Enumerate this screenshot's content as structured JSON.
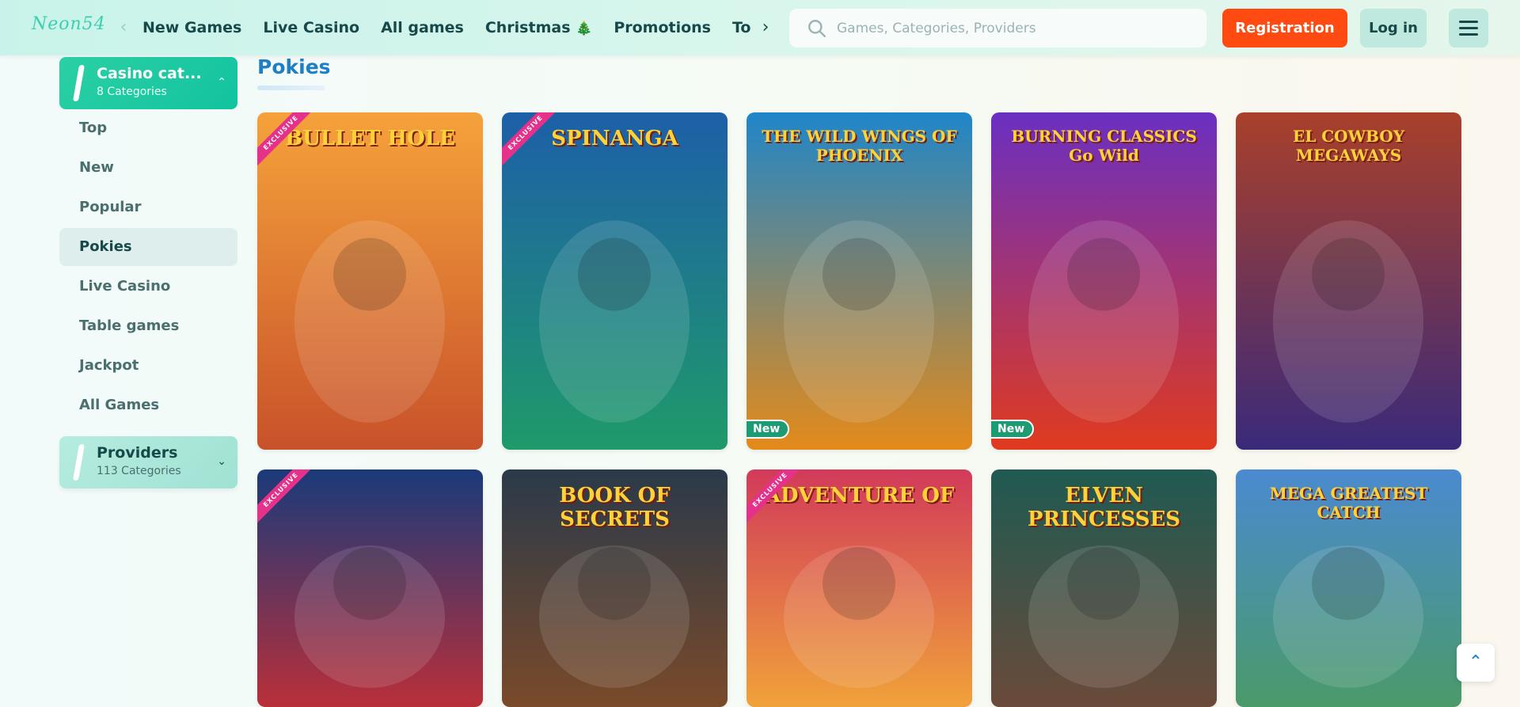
{
  "header": {
    "logo": "Neon54",
    "nav": [
      "New Games",
      "Live Casino",
      "All games",
      "Christmas",
      "Promotions",
      "Tournamer"
    ],
    "search_placeholder": "Games, Categories, Providers",
    "register_label": "Registration",
    "login_label": "Log in"
  },
  "sidebar": {
    "casino_title": "Casino cat...",
    "casino_sub": "8 Categories",
    "items": [
      "Top",
      "New",
      "Popular",
      "Pokies",
      "Live Casino",
      "Table games",
      "Jackpot",
      "All Games"
    ],
    "active": "Pokies",
    "providers_title": "Providers",
    "providers_sub": "113 Categories"
  },
  "main": {
    "title": "Pokies",
    "ribbon_text": "EXCLUSIVE",
    "new_badge": "New",
    "games": [
      {
        "title": "BULLET HOLE",
        "colors": [
          "#f5a23b",
          "#c8522a"
        ],
        "exclusive": true,
        "new": false
      },
      {
        "title": "SPINANGA",
        "colors": [
          "#1d5fa8",
          "#1f9a6a"
        ],
        "exclusive": true,
        "new": false
      },
      {
        "title": "THE WILD WINGS OF PHOENIX",
        "colors": [
          "#1f86c9",
          "#e48a1a"
        ],
        "exclusive": false,
        "new": true
      },
      {
        "title": "BURNING CLASSICS Go Wild",
        "colors": [
          "#6a2fc2",
          "#e03a1e"
        ],
        "exclusive": false,
        "new": true
      },
      {
        "title": "EL COWBOY MEGAWAYS",
        "colors": [
          "#a9402b",
          "#3a2a7a"
        ],
        "exclusive": false,
        "new": false
      },
      {
        "title": "",
        "colors": [
          "#1a3a7a",
          "#b92f3a"
        ],
        "exclusive": true,
        "new": false
      },
      {
        "title": "BOOK OF SECRETS",
        "colors": [
          "#2a3a4a",
          "#7a4a2a"
        ],
        "exclusive": false,
        "new": false
      },
      {
        "title": "ADVENTURE OF",
        "colors": [
          "#d23a5a",
          "#f0a23a"
        ],
        "exclusive": true,
        "new": false
      },
      {
        "title": "ELVEN PRINCESSES",
        "colors": [
          "#1f5a52",
          "#6a4a3a"
        ],
        "exclusive": false,
        "new": false
      },
      {
        "title": "MEGA GREATEST CATCH",
        "colors": [
          "#4a8ad0",
          "#4a9a6a"
        ],
        "exclusive": false,
        "new": false
      }
    ]
  }
}
